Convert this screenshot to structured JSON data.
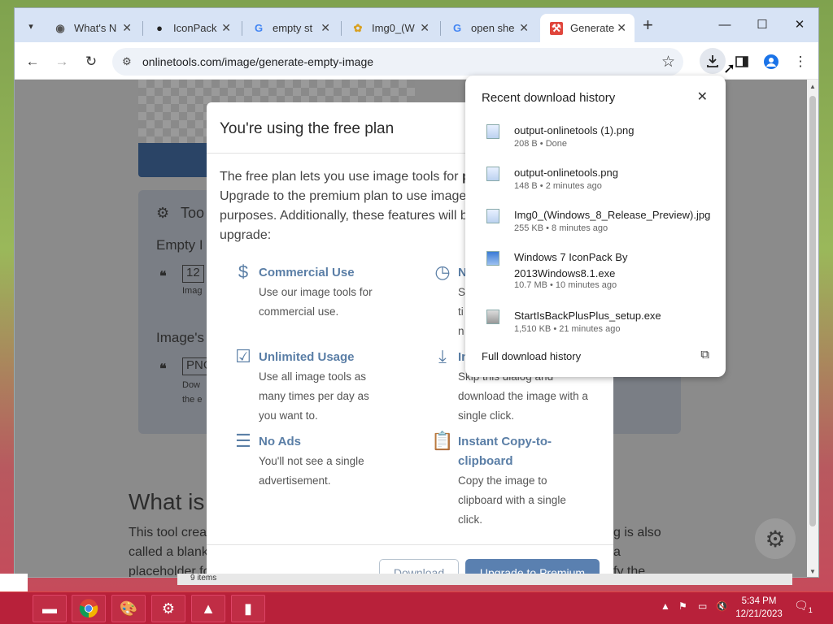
{
  "browser": {
    "tabs": [
      {
        "title": "What's N",
        "icon": "chrome-icon"
      },
      {
        "title": "IconPack",
        "icon": "github-icon"
      },
      {
        "title": "empty st",
        "icon": "google-icon"
      },
      {
        "title": "Img0_(W",
        "icon": "flower-icon"
      },
      {
        "title": "open she",
        "icon": "google-icon"
      },
      {
        "title": "Generate",
        "icon": "wrench-icon"
      }
    ],
    "url": "onlinetools.com/image/generate-empty-image"
  },
  "background_page": {
    "tools_label": "Too",
    "empty_label": "Empty I",
    "width_value": "12",
    "image_hint": "Imag",
    "images_label": "Image's",
    "format_value": "PNG",
    "format_hint_1": "Dow",
    "format_hint_2": "the e",
    "section_title": "What is",
    "para_line1_left": "This tool crea",
    "para_line1_right": "g is also",
    "para_line2_left": "called a blank",
    "para_line2_right": "a",
    "para_line3_left": "placeholder fo",
    "para_line3_right": "fy the"
  },
  "modal": {
    "title": "You're using the free plan",
    "intro_html_1": "The free plan lets you use image tools for ",
    "intro_bold": "p",
    "intro_2": "Upgrade to the premium plan to use image",
    "intro_3": "purposes. Additionally, these features will b",
    "intro_4": "upgrade:",
    "features": [
      {
        "title": "Commercial Use",
        "desc": "Use our image tools for commercial use.",
        "icon": "dollar-icon"
      },
      {
        "title": "N",
        "desc": "S ti in",
        "icon": "clock-icon"
      },
      {
        "title": "Unlimited Usage",
        "desc": "Use all image tools as many times per day as you want to.",
        "icon": "calendar-check-icon"
      },
      {
        "title": "In",
        "desc": "Skip this dialog and download the image with a single click.",
        "icon": "download-icon"
      },
      {
        "title": "No Ads",
        "desc": "You'll not see a single advertisement.",
        "icon": "ad-icon"
      },
      {
        "title": "Instant Copy-to-clipboard",
        "desc": "Copy the image to clipboard with a single click.",
        "icon": "clipboard-icon"
      }
    ],
    "download_label": "Download",
    "upgrade_label": "Upgrade to Premium"
  },
  "downloads": {
    "title": "Recent download history",
    "items": [
      {
        "name": "output-onlinetools (1).png",
        "meta": "208 B • Done"
      },
      {
        "name": "output-onlinetools.png",
        "meta": "148 B • 2 minutes ago"
      },
      {
        "name": "Img0_(Windows_8_Release_Preview).jpg",
        "meta": "255 KB • 8 minutes ago"
      },
      {
        "name": "Windows 7 IconPack By 2013Windows8.1.exe",
        "meta": "10.7 MB • 10 minutes ago"
      },
      {
        "name": "StartIsBackPlusPlus_setup.exe",
        "meta": "1,510 KB • 21 minutes ago"
      }
    ],
    "full_history": "Full download history"
  },
  "explorer_strip": "9 items",
  "taskbar": {
    "time": "5:34 PM",
    "date": "12/21/2023",
    "notif_count": "1"
  }
}
